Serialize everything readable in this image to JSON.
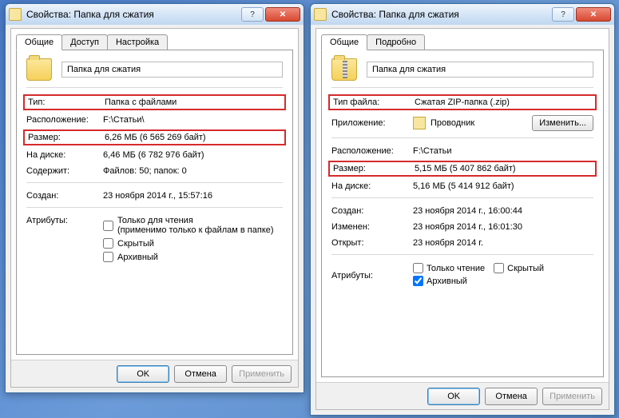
{
  "win1": {
    "title": "Свойства: Папка для сжатия",
    "tabs": [
      "Общие",
      "Доступ",
      "Настройка"
    ],
    "name": "Папка для сжатия",
    "type_lbl": "Тип:",
    "type_val": "Папка с файлами",
    "loc_lbl": "Расположение:",
    "loc_val": "F:\\Статьи\\",
    "size_lbl": "Размер:",
    "size_val": "6,26 МБ (6 565 269 байт)",
    "disk_lbl": "На диске:",
    "disk_val": "6,46 МБ (6 782 976 байт)",
    "cont_lbl": "Содержит:",
    "cont_val": "Файлов: 50; папок: 0",
    "created_lbl": "Создан:",
    "created_val": "23 ноября 2014 г., 15:57:16",
    "attr_lbl": "Атрибуты:",
    "attr_ro": "Только для чтения",
    "attr_ro_sub": "(применимо только к файлам в папке)",
    "attr_hidden": "Скрытый",
    "attr_archive": "Архивный",
    "btn_ok": "OK",
    "btn_cancel": "Отмена",
    "btn_apply": "Применить"
  },
  "win2": {
    "title": "Свойства: Папка для сжатия",
    "tabs": [
      "Общие",
      "Подробно"
    ],
    "name": "Папка для сжатия",
    "type_lbl": "Тип файла:",
    "type_val": "Сжатая ZIP-папка (.zip)",
    "app_lbl": "Приложение:",
    "app_val": "Проводник",
    "btn_change": "Изменить...",
    "loc_lbl": "Расположение:",
    "loc_val": "F:\\Статьи",
    "size_lbl": "Размер:",
    "size_val": "5,15 МБ (5 407 862 байт)",
    "disk_lbl": "На диске:",
    "disk_val": "5,16 МБ (5 414 912 байт)",
    "created_lbl": "Создан:",
    "created_val": "23 ноября 2014 г., 16:00:44",
    "modified_lbl": "Изменен:",
    "modified_val": "23 ноября 2014 г., 16:01:30",
    "opened_lbl": "Открыт:",
    "opened_val": "23 ноября 2014 г.",
    "attr_lbl": "Атрибуты:",
    "attr_ro": "Только чтение",
    "attr_hidden": "Скрытый",
    "attr_archive": "Архивный",
    "btn_ok": "OK",
    "btn_cancel": "Отмена",
    "btn_apply": "Применить"
  }
}
